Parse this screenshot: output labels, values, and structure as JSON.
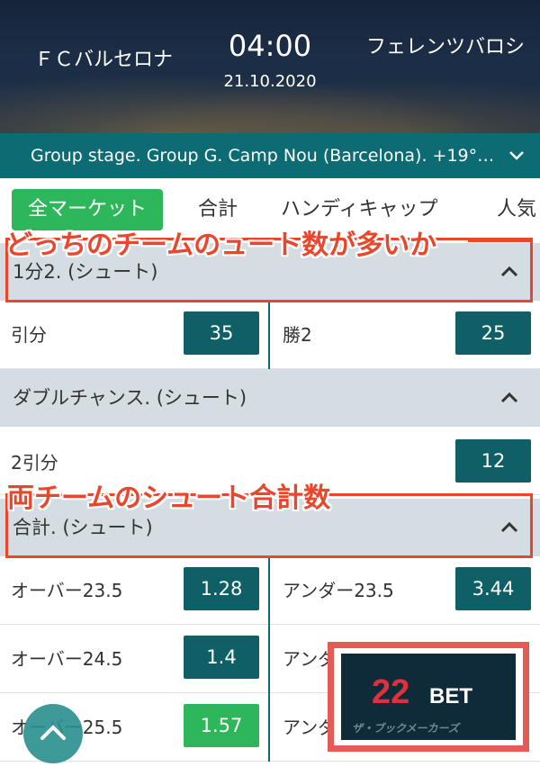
{
  "match": {
    "home_team": "ＦＣバルセロナ",
    "away_team": "フェレンツバロシ",
    "time": "04:00",
    "date": "21.10.2020",
    "info": "Group stage. Group G. Camp Nou (Barcelona). +19°C. 1..."
  },
  "tabs": [
    {
      "label": "全マーケット",
      "active": true
    },
    {
      "label": "合計"
    },
    {
      "label": "ハンディキャップ"
    },
    {
      "label": "人気"
    }
  ],
  "annotations": {
    "first": "どっちのチームのュート数が多いか",
    "second": "両チームのシュート合計数"
  },
  "sections": {
    "shots_1x2": {
      "title": "1分2. (シュート)",
      "rows": [
        {
          "left_label": "引分",
          "left_odd": "35",
          "right_label": "勝2",
          "right_odd": "25"
        }
      ]
    },
    "double_chance": {
      "title": "ダブルチャンス. (シュート)",
      "rows": [
        {
          "left_label": "2引分",
          "right_odd": "12"
        }
      ]
    },
    "total_shots": {
      "title": "合計. (シュート)",
      "rows": [
        {
          "left_label": "オーバー23.5",
          "left_odd": "1.28",
          "right_label": "アンダー23.5",
          "right_odd": "3.44"
        },
        {
          "left_label": "オーバー24.5",
          "left_odd": "1.4",
          "right_label": "アンダー24.5",
          "right_odd": ""
        },
        {
          "left_label": "オーバー25.5",
          "left_odd": "1.57",
          "right_label": "アンダー25.5",
          "right_odd": ""
        }
      ]
    }
  },
  "logo": {
    "number": "22",
    "word": "BET",
    "watermark": "ザ・ブックメーカーズ"
  },
  "colors": {
    "teal": "#0d6b73",
    "green": "#2eb65a",
    "annotation_red": "#e8472c",
    "section_gray": "#d3dde2"
  }
}
